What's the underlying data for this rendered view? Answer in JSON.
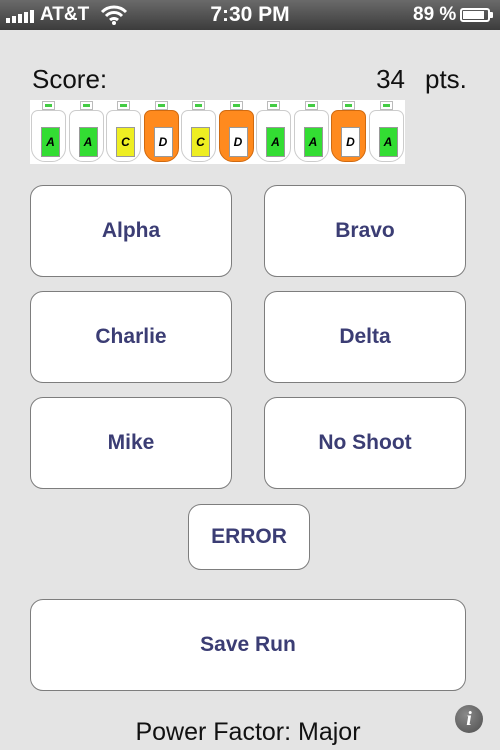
{
  "status_bar": {
    "carrier": "AT&T",
    "time": "7:30 PM",
    "battery_percent": "89 %",
    "battery_level": 0.89,
    "signal_icon": "signal-bars-icon",
    "wifi_icon": "wifi-icon",
    "battery_icon": "battery-icon"
  },
  "score": {
    "label": "Score:",
    "value": "34",
    "unit": "pts."
  },
  "hits": [
    {
      "zone": "A",
      "color": "#33dd33"
    },
    {
      "zone": "A",
      "color": "#33dd33"
    },
    {
      "zone": "C",
      "color": "#eeee22"
    },
    {
      "zone": "D",
      "color": "#ff8a1e"
    },
    {
      "zone": "C",
      "color": "#eeee22"
    },
    {
      "zone": "D",
      "color": "#ff8a1e"
    },
    {
      "zone": "A",
      "color": "#33dd33"
    },
    {
      "zone": "A",
      "color": "#33dd33"
    },
    {
      "zone": "D",
      "color": "#ff8a1e"
    },
    {
      "zone": "A",
      "color": "#33dd33"
    }
  ],
  "buttons": {
    "alpha": "Alpha",
    "bravo": "Bravo",
    "charlie": "Charlie",
    "delta": "Delta",
    "mike": "Mike",
    "no_shoot": "No Shoot",
    "error": "ERROR",
    "save_run": "Save Run"
  },
  "footer": {
    "power_factor": "Power Factor: Major",
    "info_icon": "info-icon"
  },
  "colors": {
    "button_text": "#3b3d74",
    "background": "#e4e4e4"
  }
}
